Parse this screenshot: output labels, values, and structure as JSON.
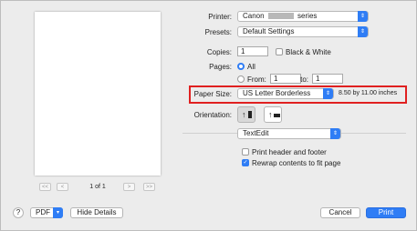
{
  "preview": {
    "page_indicator": "1 of 1",
    "first_btn": "<<",
    "prev_btn": "<",
    "next_btn": ">",
    "last_btn": ">>"
  },
  "printer": {
    "label": "Printer:",
    "value_prefix": "Canon",
    "value_suffix": "series"
  },
  "presets": {
    "label": "Presets:",
    "value": "Default Settings"
  },
  "copies": {
    "label": "Copies:",
    "value": "1",
    "bw_label": "Black & White",
    "bw_checked": false
  },
  "pages": {
    "label": "Pages:",
    "all_label": "All",
    "from_label": "From:",
    "from_value": "1",
    "to_label": "to:",
    "to_value": "1"
  },
  "paper_size": {
    "label": "Paper Size:",
    "value": "US Letter Borderless",
    "dimensions": "8.50 by 11.00 inches"
  },
  "orientation": {
    "label": "Orientation:",
    "portrait_glyph": "↑",
    "landscape_glyph": "↑"
  },
  "app_section": {
    "value": "TextEdit"
  },
  "options": {
    "header_footer_label": "Print header and footer",
    "header_footer_checked": false,
    "rewrap_label": "Rewrap contents to fit page",
    "rewrap_checked": true
  },
  "bottom": {
    "help_label": "?",
    "pdf_label": "PDF",
    "hide_details_label": "Hide Details",
    "cancel_label": "Cancel",
    "print_label": "Print"
  },
  "colors": {
    "accent": "#2f7df5",
    "highlight": "#e02020"
  }
}
